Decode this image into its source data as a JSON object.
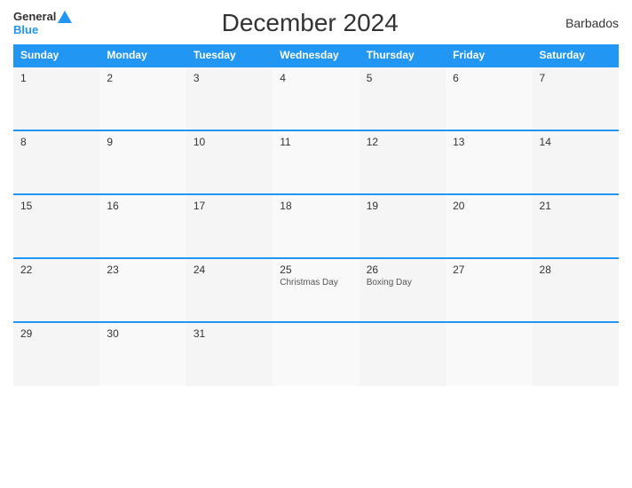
{
  "header": {
    "title": "December 2024",
    "country": "Barbados",
    "logo_general": "General",
    "logo_blue": "Blue"
  },
  "calendar": {
    "days_of_week": [
      "Sunday",
      "Monday",
      "Tuesday",
      "Wednesday",
      "Thursday",
      "Friday",
      "Saturday"
    ],
    "weeks": [
      [
        {
          "date": "1",
          "event": ""
        },
        {
          "date": "2",
          "event": ""
        },
        {
          "date": "3",
          "event": ""
        },
        {
          "date": "4",
          "event": ""
        },
        {
          "date": "5",
          "event": ""
        },
        {
          "date": "6",
          "event": ""
        },
        {
          "date": "7",
          "event": ""
        }
      ],
      [
        {
          "date": "8",
          "event": ""
        },
        {
          "date": "9",
          "event": ""
        },
        {
          "date": "10",
          "event": ""
        },
        {
          "date": "11",
          "event": ""
        },
        {
          "date": "12",
          "event": ""
        },
        {
          "date": "13",
          "event": ""
        },
        {
          "date": "14",
          "event": ""
        }
      ],
      [
        {
          "date": "15",
          "event": ""
        },
        {
          "date": "16",
          "event": ""
        },
        {
          "date": "17",
          "event": ""
        },
        {
          "date": "18",
          "event": ""
        },
        {
          "date": "19",
          "event": ""
        },
        {
          "date": "20",
          "event": ""
        },
        {
          "date": "21",
          "event": ""
        }
      ],
      [
        {
          "date": "22",
          "event": ""
        },
        {
          "date": "23",
          "event": ""
        },
        {
          "date": "24",
          "event": ""
        },
        {
          "date": "25",
          "event": "Christmas Day"
        },
        {
          "date": "26",
          "event": "Boxing Day"
        },
        {
          "date": "27",
          "event": ""
        },
        {
          "date": "28",
          "event": ""
        }
      ],
      [
        {
          "date": "29",
          "event": ""
        },
        {
          "date": "30",
          "event": ""
        },
        {
          "date": "31",
          "event": ""
        },
        {
          "date": "",
          "event": ""
        },
        {
          "date": "",
          "event": ""
        },
        {
          "date": "",
          "event": ""
        },
        {
          "date": "",
          "event": ""
        }
      ]
    ]
  }
}
